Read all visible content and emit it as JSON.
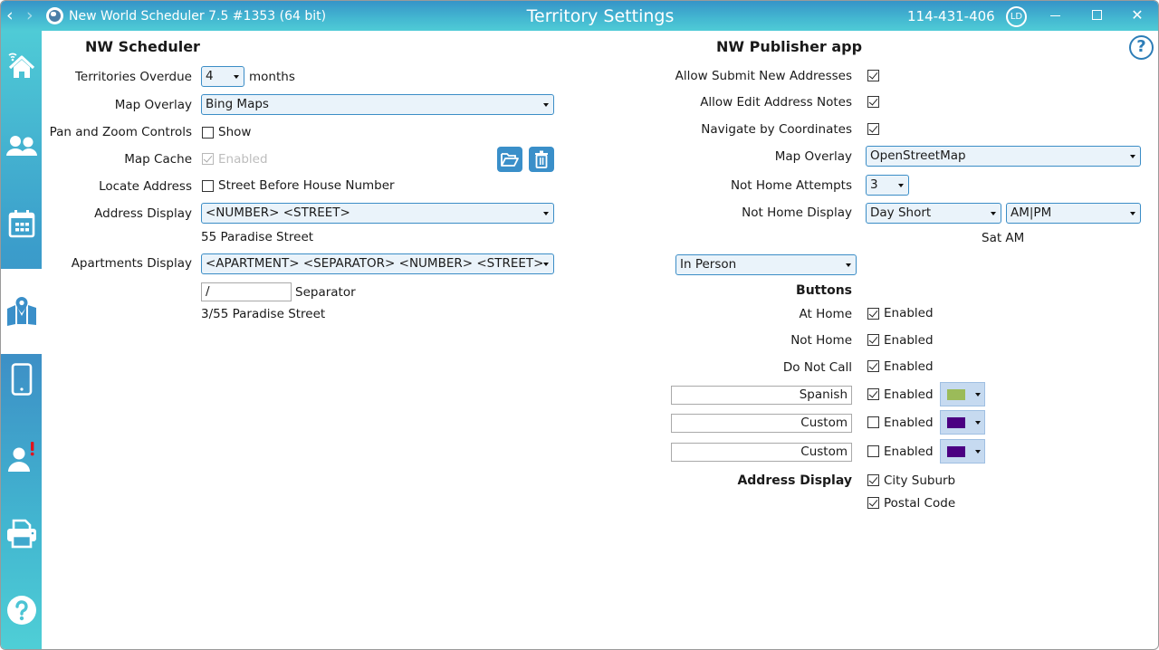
{
  "window": {
    "app_name": "New World Scheduler 7.5 #1353 (64 bit)",
    "page_title": "Territory Settings",
    "user_id": "114-431-406",
    "avatar_initials": "LD",
    "nav_back": "‹",
    "nav_forward": "›",
    "close_glyph": "✕"
  },
  "sidebar": {
    "items": [
      {
        "name": "home",
        "icon": "home-wifi-icon"
      },
      {
        "name": "people",
        "icon": "people-icon"
      },
      {
        "name": "calendar",
        "icon": "calendar-icon"
      },
      {
        "name": "territories",
        "icon": "map-icon",
        "active": true
      },
      {
        "name": "mobile",
        "icon": "mobile-phone-icon"
      },
      {
        "name": "user-alert",
        "icon": "user-alert-icon",
        "badge": "!"
      },
      {
        "name": "print",
        "icon": "printer-icon"
      },
      {
        "name": "help",
        "icon": "help-icon"
      }
    ]
  },
  "help_glyph": "?",
  "scheduler": {
    "heading": "NW Scheduler",
    "territories_overdue": {
      "label": "Territories Overdue",
      "value": "4",
      "suffix": "months"
    },
    "map_overlay": {
      "label": "Map Overlay",
      "value": "Bing Maps"
    },
    "pan_zoom": {
      "label": "Pan and Zoom Controls",
      "checkbox_label": "Show",
      "checked": false
    },
    "map_cache": {
      "label": "Map Cache",
      "checkbox_label": "Enabled",
      "checked": true,
      "disabled": true
    },
    "locate_address": {
      "label": "Locate Address",
      "checkbox_label": "Street Before House Number",
      "checked": false
    },
    "address_display": {
      "label": "Address Display",
      "value": "<NUMBER> <STREET>",
      "preview": "55 Paradise Street"
    },
    "apartments_display": {
      "label": "Apartments Display",
      "value": "<APARTMENT> <SEPARATOR> <NUMBER> <STREET>",
      "separator_value": "/",
      "separator_label": "Separator",
      "preview": "3/55 Paradise Street"
    }
  },
  "publisher": {
    "heading": "NW Publisher app",
    "allow_submit": {
      "label": "Allow Submit New Addresses",
      "checked": true
    },
    "allow_edit_notes": {
      "label": "Allow Edit Address Notes",
      "checked": true
    },
    "navigate_coords": {
      "label": "Navigate by Coordinates",
      "checked": true
    },
    "map_overlay": {
      "label": "Map Overlay",
      "value": "OpenStreetMap"
    },
    "not_home_attempts": {
      "label": "Not Home Attempts",
      "value": "3"
    },
    "not_home_display": {
      "label": "Not Home Display",
      "day_value": "Day Short",
      "time_value": "AM|PM",
      "preview": "Sat AM"
    },
    "mode": {
      "value": "In Person"
    },
    "buttons": {
      "heading": "Buttons",
      "rows": [
        {
          "label": "At Home",
          "checkbox_label": "Enabled",
          "checked": true
        },
        {
          "label": "Not Home",
          "checkbox_label": "Enabled",
          "checked": true
        },
        {
          "label": "Do Not Call",
          "checkbox_label": "Enabled",
          "checked": true
        }
      ],
      "custom_rows": [
        {
          "value": "Spanish",
          "checkbox_label": "Enabled",
          "checked": true,
          "color": "#9bbb59"
        },
        {
          "value": "Custom",
          "checkbox_label": "Enabled",
          "checked": false,
          "color": "#4b0082"
        },
        {
          "value": "Custom",
          "checkbox_label": "Enabled",
          "checked": false,
          "color": "#4b0082"
        }
      ]
    },
    "address_display": {
      "heading": "Address Display",
      "city_suburb": {
        "label": "City Suburb",
        "checked": true
      },
      "postal_code": {
        "label": "Postal Code",
        "checked": true
      }
    }
  }
}
